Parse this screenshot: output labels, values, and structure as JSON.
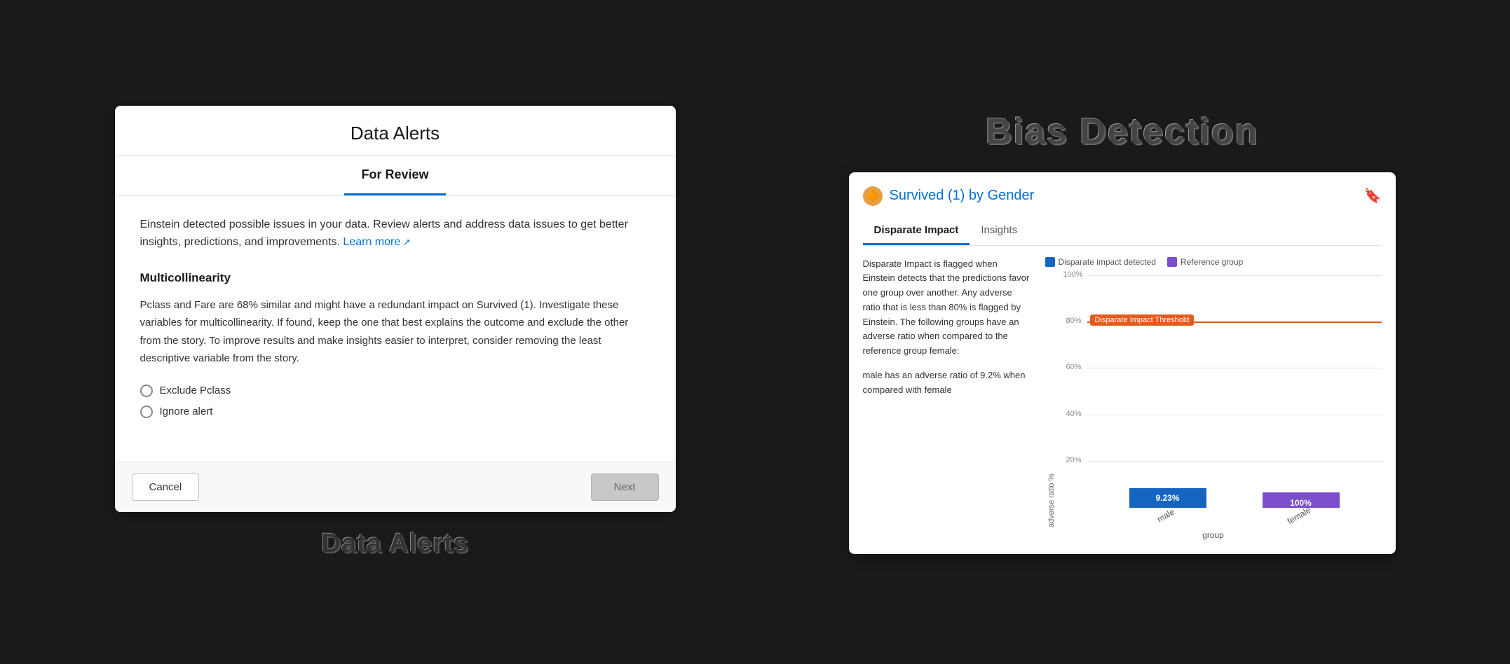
{
  "modal": {
    "title": "Data Alerts",
    "tabs": [
      {
        "id": "for-review",
        "label": "For Review",
        "active": true
      }
    ],
    "description": "Einstein detected possible issues in your data. Review alerts and address data issues to get better insights, predictions, and improvements.",
    "learn_more": "Learn more",
    "section": {
      "title": "Multicollinearity",
      "body": "Pclass and Fare are 68% similar and might have a redundant impact on Survived (1). Investigate these variables for multicollinearity. If found, keep the one that best explains the outcome and exclude the other from the story. To improve results and make insights easier to interpret, consider removing the least descriptive variable from the story.",
      "options": [
        {
          "id": "exclude-pclass",
          "label": "Exclude Pclass"
        },
        {
          "id": "ignore-alert",
          "label": "Ignore alert"
        }
      ]
    },
    "footer": {
      "cancel_label": "Cancel",
      "next_label": "Next"
    }
  },
  "bias_detection": {
    "page_title": "Bias Detection",
    "card": {
      "title_prefix": "Survived (1) by",
      "title_highlight": "Gender",
      "tabs": [
        {
          "id": "disparate-impact",
          "label": "Disparate Impact",
          "active": true
        },
        {
          "id": "insights",
          "label": "Insights",
          "active": false
        }
      ],
      "description": "Disparate Impact is flagged when Einstein detects that the predictions favor one group over another. Any adverse ratio that is less than 80% is flagged by Einstein. The following groups have an adverse ratio when compared to the reference group female:",
      "adverse_note": "male has an adverse ratio of 9.2% when compared with female",
      "legend": [
        {
          "id": "disparate-impact-legend",
          "label": "Disparate impact detected",
          "color": "#1565c0"
        },
        {
          "id": "reference-group-legend",
          "label": "Reference group",
          "color": "#7c4dcc"
        }
      ],
      "chart": {
        "y_axis_label": "adverse ratio %",
        "x_axis_label": "group",
        "threshold_label": "Disparate Impact Threshold",
        "threshold_pct": 80,
        "grid_lines": [
          "100%",
          "80%",
          "60%",
          "40%",
          "20%"
        ],
        "bars": [
          {
            "id": "male-bar",
            "label": "male",
            "value": "9.23%",
            "height_pct": 9.23,
            "color": "#1565c0"
          },
          {
            "id": "female-bar",
            "label": "female",
            "value": "100%",
            "height_pct": 100,
            "color": "#7c4dcc"
          }
        ]
      }
    }
  },
  "bottom_labels": {
    "data_alerts": "Data Alerts",
    "bias_detection": "Bias Detection"
  }
}
